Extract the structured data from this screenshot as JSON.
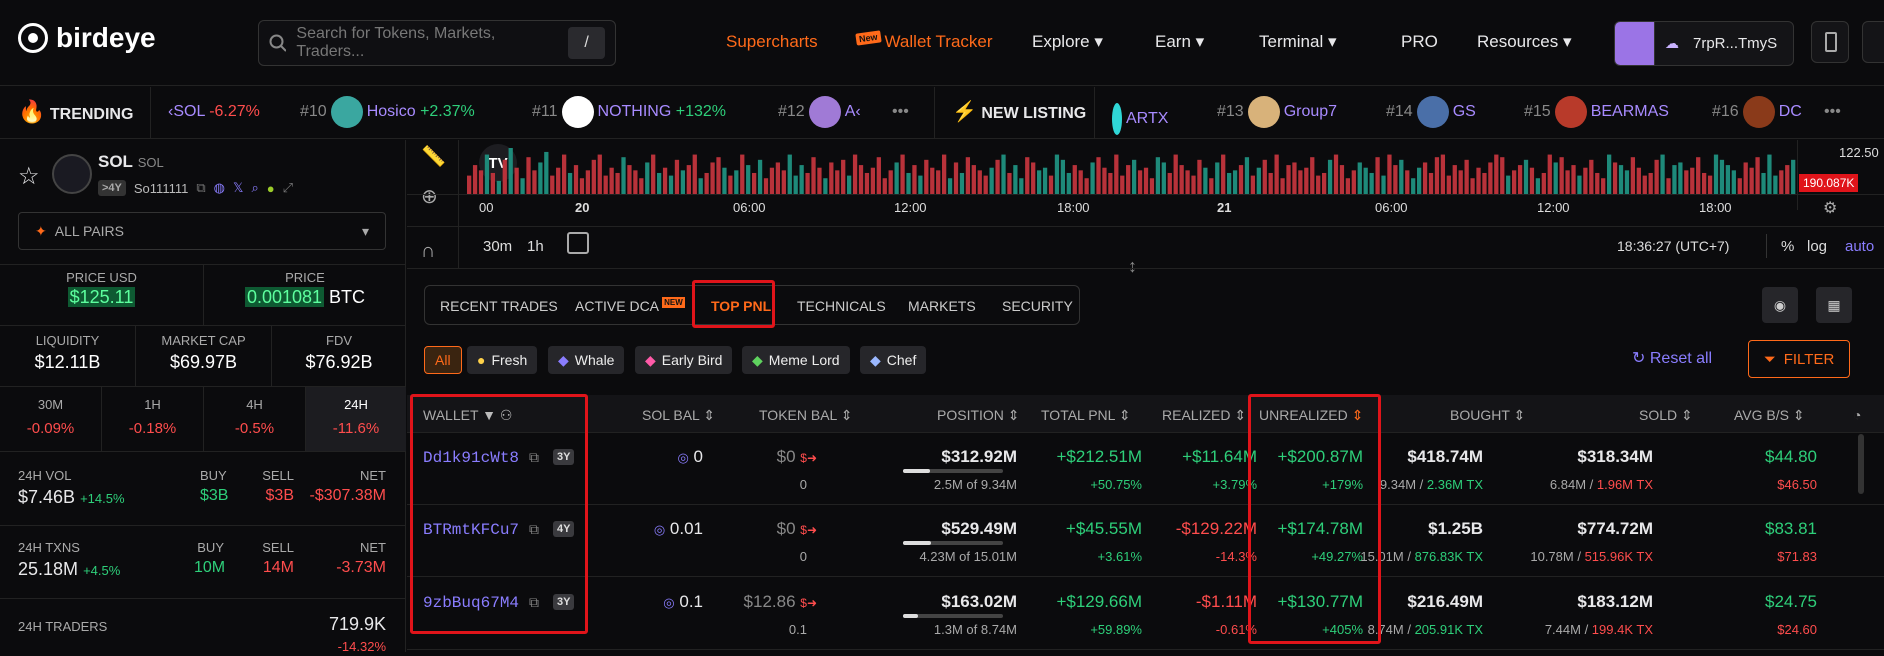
{
  "brand": {
    "name": "birdeye"
  },
  "search": {
    "placeholder": "Search for Tokens, Markets, Traders...",
    "shortcut": "/"
  },
  "nav": {
    "supercharts": "Supercharts",
    "new_badge": "New",
    "wallet_tracker": "Wallet Tracker",
    "explore": "Explore",
    "earn": "Earn",
    "terminal": "Terminal",
    "pro": "PRO",
    "resources": "Resources"
  },
  "wallet": {
    "address": "7rpR...TmyS"
  },
  "ticker": {
    "trending_label": "TRENDING",
    "trending": [
      {
        "name": "‹SOL",
        "change": "-6.27%",
        "dir": "down"
      },
      {
        "rank": "#10",
        "name": "Hosico",
        "change": "+2.37%",
        "dir": "up"
      },
      {
        "rank": "#11",
        "name": "NOTHING",
        "change": "+132%",
        "dir": "up"
      },
      {
        "rank": "#12",
        "name": "A‹",
        "change": "",
        "dir": "up"
      }
    ],
    "new_listing_label": "NEW LISTING",
    "new_listing": [
      {
        "rank": "",
        "name": "ARTX"
      },
      {
        "rank": "#13",
        "name": "Group7"
      },
      {
        "rank": "#14",
        "name": "GS"
      },
      {
        "rank": "#15",
        "name": "BEARMAS"
      },
      {
        "rank": "#16",
        "name": "DC"
      }
    ]
  },
  "token": {
    "symbol": "SOL",
    "name": "SOL",
    "age": ">4Y",
    "address": "So111111",
    "pair_selector": "ALL PAIRS"
  },
  "price": {
    "usd_label": "PRICE USD",
    "usd": "$125.11",
    "native_label": "PRICE",
    "native": "0.001081",
    "native_unit": "BTC"
  },
  "stats": {
    "liquidity_label": "LIQUIDITY",
    "liquidity": "$12.11B",
    "mcap_label": "MARKET CAP",
    "mcap": "$69.97B",
    "fdv_label": "FDV",
    "fdv": "$76.92B"
  },
  "timeframes": [
    {
      "label": "30M",
      "change": "-0.09%"
    },
    {
      "label": "1H",
      "change": "-0.18%"
    },
    {
      "label": "4H",
      "change": "-0.5%"
    },
    {
      "label": "24H",
      "change": "-11.6%"
    }
  ],
  "vol": {
    "label": "24H VOL",
    "value": "$7.46B",
    "change": "+14.5%",
    "buy_label": "BUY",
    "buy": "$3B",
    "sell_label": "SELL",
    "sell": "$3B",
    "net_label": "NET",
    "net": "-$307.38M"
  },
  "txns": {
    "label": "24H TXNS",
    "value": "25.18M",
    "change": "+4.5%",
    "buy_label": "BUY",
    "buy": "10M",
    "sell_label": "SELL",
    "sell": "14M",
    "net_label": "NET",
    "net": "-3.73M"
  },
  "traders": {
    "label": "24H TRADERS",
    "value": "719.9K",
    "change": "-14.32%"
  },
  "chart": {
    "price_tick": "122.50",
    "volume_tag": "190.087K",
    "time_ticks": [
      "00",
      "20",
      "06:00",
      "12:00",
      "18:00",
      "21",
      "06:00",
      "12:00",
      "18:00"
    ],
    "intervals": [
      "30m",
      "1h"
    ],
    "clock": "18:36:27 (UTC+7)",
    "scale_opts": [
      "%",
      "log",
      "auto"
    ],
    "volume_bars": [
      14,
      22,
      18,
      30,
      16,
      10,
      26,
      35,
      20,
      12,
      28,
      18,
      24,
      32,
      14,
      20,
      30,
      16,
      22,
      12,
      18,
      26,
      30,
      14,
      20,
      16,
      28,
      22,
      18,
      12,
      24,
      30,
      16,
      20,
      14,
      26,
      18,
      22,
      30,
      12,
      16,
      24,
      28,
      20,
      14,
      18,
      30,
      22,
      16,
      26,
      12,
      20,
      24,
      18,
      30,
      14,
      22,
      16,
      28,
      20,
      12,
      24,
      18,
      26,
      14,
      30,
      22,
      16,
      20,
      28,
      12,
      18,
      24,
      30,
      16,
      22,
      14,
      26,
      20,
      18,
      30,
      12,
      24,
      16,
      28,
      22,
      18,
      14,
      20,
      26,
      30,
      16,
      22,
      12,
      28,
      24,
      18,
      20,
      14,
      30,
      26,
      16,
      22,
      18,
      12,
      24,
      28,
      20,
      16,
      30,
      14,
      22,
      26,
      18,
      20,
      12,
      28,
      24,
      16,
      30,
      22,
      18,
      14,
      26,
      20,
      12,
      24,
      30,
      16,
      18,
      22,
      28,
      14,
      20,
      26,
      16,
      30,
      12,
      22,
      24,
      18,
      20,
      28,
      14,
      16,
      26,
      30,
      22,
      12,
      18,
      24,
      20,
      16,
      28,
      14,
      30,
      22,
      26,
      18,
      12,
      20,
      24,
      16,
      28,
      30,
      14,
      22,
      18,
      26,
      12,
      20,
      16,
      24,
      30,
      28,
      14,
      18,
      22,
      26,
      20,
      12,
      16,
      30,
      24,
      28,
      18,
      22,
      14,
      20,
      26,
      16,
      12,
      30,
      24,
      22,
      18,
      28,
      20,
      14,
      16,
      26,
      30,
      12,
      22,
      24,
      18,
      20,
      28,
      16,
      14,
      30,
      26,
      22,
      18,
      12,
      24,
      20,
      28,
      16,
      30,
      14,
      18,
      22,
      26
    ]
  },
  "tabs": [
    "RECENT TRADES",
    "ACTIVE DCA",
    "TOP PNL",
    "TECHNICALS",
    "MARKETS",
    "SECURITY"
  ],
  "tab_new_badge": "NEW",
  "filters": [
    "All",
    "Fresh",
    "Whale",
    "Early Bird",
    "Meme Lord",
    "Chef"
  ],
  "reset_label": "Reset all",
  "filter_label": "FILTER",
  "columns": [
    "WALLET",
    "SOL BAL",
    "TOKEN BAL",
    "POSITION",
    "TOTAL PNL",
    "REALIZED",
    "UNREALIZED",
    "BOUGHT",
    "SOLD",
    "AVG B/S"
  ],
  "rows": [
    {
      "wallet": "Dd1k91cWt8",
      "age": "3Y",
      "sol_bal": "0",
      "token_bal": "$0",
      "token_qty": "0",
      "position": "$312.92M",
      "position_fill": 0.27,
      "position_sub": "2.5M of 9.34M",
      "total_pnl": "+$212.51M",
      "total_pnl_pct": "+50.75%",
      "realized": "+$11.64M",
      "realized_pct": "+3.79%",
      "realized_dir": "up",
      "unrealized": "+$200.87M",
      "unrealized_pct": "+179%",
      "bought": "$418.74M",
      "bought_qty": "9.34M",
      "bought_tx": "2.36M TX",
      "sold": "$318.34M",
      "sold_qty": "6.84M",
      "sold_tx": "1.96M TX",
      "avg_buy": "$44.80",
      "avg_sell": "$46.50"
    },
    {
      "wallet": "BTRmtKFCu7",
      "age": "4Y",
      "sol_bal": "0.01",
      "token_bal": "$0",
      "token_qty": "0",
      "position": "$529.49M",
      "position_fill": 0.28,
      "position_sub": "4.23M of 15.01M",
      "total_pnl": "+$45.55M",
      "total_pnl_pct": "+3.61%",
      "realized": "-$129.22M",
      "realized_pct": "-14.3%",
      "realized_dir": "down",
      "unrealized": "+$174.78M",
      "unrealized_pct": "+49.27%",
      "bought": "$1.25B",
      "bought_qty": "15.01M",
      "bought_tx": "876.83K TX",
      "sold": "$774.72M",
      "sold_qty": "10.78M",
      "sold_tx": "515.96K TX",
      "avg_buy": "$83.81",
      "avg_sell": "$71.83"
    },
    {
      "wallet": "9zbBuq67M4",
      "age": "3Y",
      "sol_bal": "0.1",
      "token_bal": "$12.86",
      "token_qty": "0.1",
      "position": "$163.02M",
      "position_fill": 0.15,
      "position_sub": "1.3M of 8.74M",
      "total_pnl": "+$129.66M",
      "total_pnl_pct": "+59.89%",
      "realized": "-$1.11M",
      "realized_pct": "-0.61%",
      "realized_dir": "down",
      "unrealized": "+$130.77M",
      "unrealized_pct": "+405%",
      "bought": "$216.49M",
      "bought_qty": "8.74M",
      "bought_tx": "205.91K TX",
      "sold": "$183.12M",
      "sold_qty": "7.44M",
      "sold_tx": "199.4K TX",
      "avg_buy": "$24.75",
      "avg_sell": "$24.60"
    }
  ],
  "colors": {
    "accent": "#ff6a1a",
    "up": "#2ecf7a",
    "down": "#ff4d4d",
    "link": "#8a7dff",
    "highlight": "#e0141a"
  }
}
